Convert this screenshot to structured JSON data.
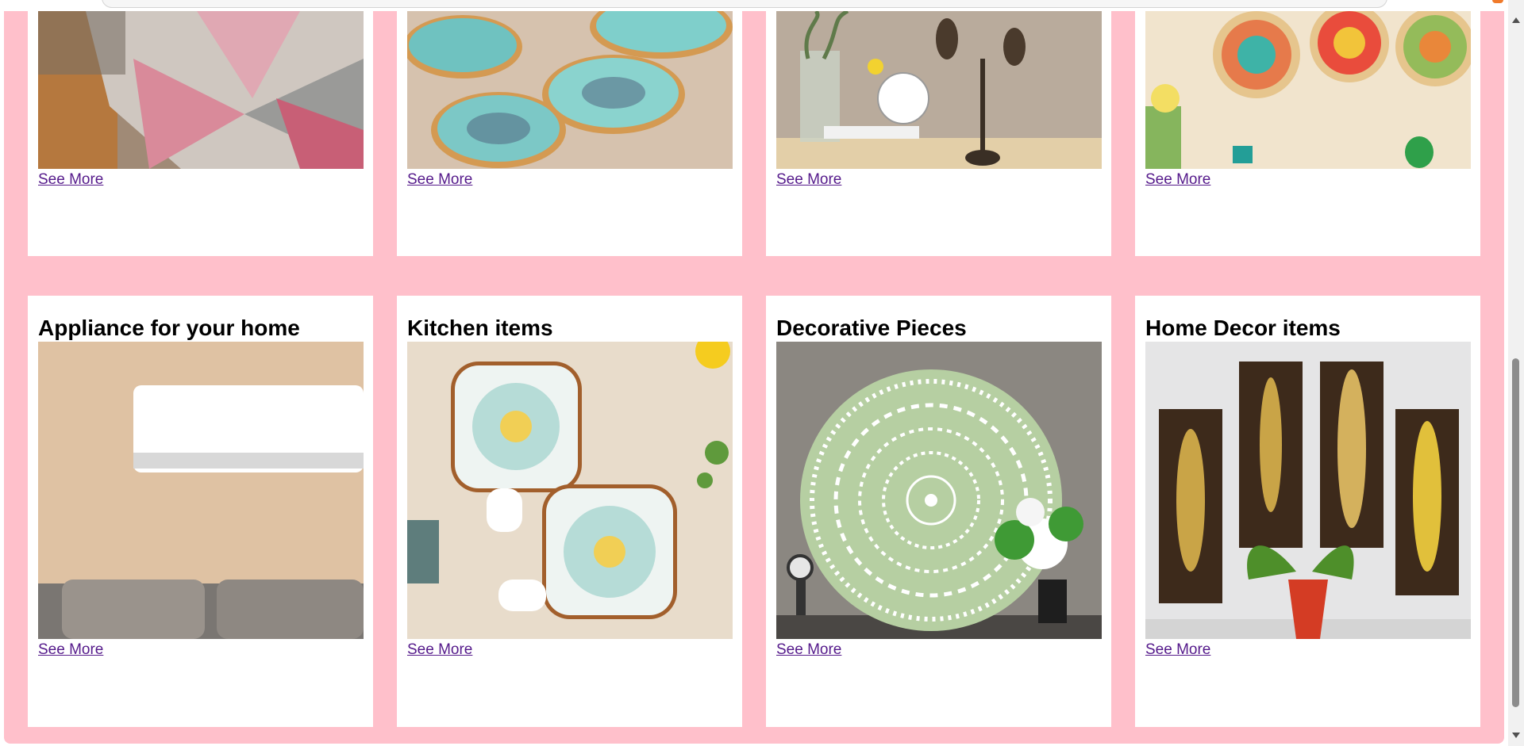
{
  "top_row": [
    {
      "link": "See More",
      "image": "patterned-rug-photo"
    },
    {
      "link": "See More",
      "image": "ceramic-bowls-photo"
    },
    {
      "link": "See More",
      "image": "bird-sculpture-shelf-photo"
    },
    {
      "link": "See More",
      "image": "wall-plates-photo"
    }
  ],
  "bottom_row": [
    {
      "title": "Appliance for your home",
      "link": "See More",
      "image": "air-conditioner-photo"
    },
    {
      "title": "Kitchen items",
      "link": "See More",
      "image": "serving-plates-photo"
    },
    {
      "title": "Decorative Pieces",
      "link": "See More",
      "image": "mandala-mirror-photo"
    },
    {
      "title": "Home Decor items",
      "link": "See More",
      "image": "leaf-wall-art-photo"
    }
  ],
  "colors": {
    "page_background": "#ffc0cb",
    "card_background": "#ffffff",
    "link": "#551a8b"
  }
}
